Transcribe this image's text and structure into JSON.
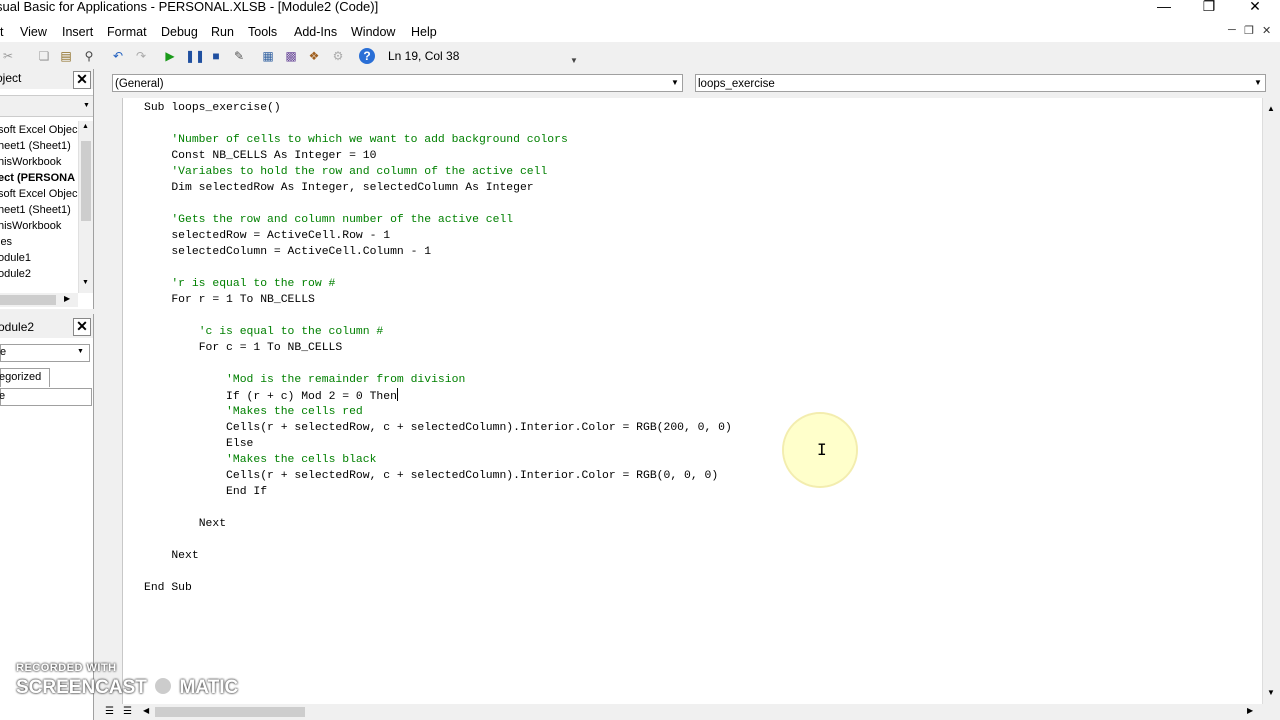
{
  "window": {
    "title": "sual Basic for Applications - PERSONAL.XLSB - [Module2 (Code)]",
    "minimize_icon": "minimize-icon",
    "restore_icon": "restore-icon",
    "close_icon": "close-icon"
  },
  "menu": {
    "items": [
      "t",
      "View",
      "Insert",
      "Format",
      "Debug",
      "Run",
      "Tools",
      "Add-Ins",
      "Window",
      "Help"
    ]
  },
  "toolbar": {
    "position": "Ln 19, Col 38"
  },
  "project_pane": {
    "title": "oject",
    "items": [
      "soft Excel Objec",
      "heet1 (Sheet1)",
      "hisWorkbook",
      "ect (PERSONA",
      "soft Excel Objec",
      "heet1 (Sheet1)",
      "hisWorkbook",
      "les",
      "odule1",
      "odule2"
    ]
  },
  "properties_pane": {
    "title": "odule2",
    "dropdown_value": "e",
    "tab_label": "egorized",
    "selected_row": "e"
  },
  "editor": {
    "object_combo": "(General)",
    "procedure_combo": "loops_exercise",
    "code_lines": [
      {
        "indent": 0,
        "text": "Sub loops_exercise()",
        "comment": false
      },
      {
        "indent": 0,
        "text": "",
        "comment": false
      },
      {
        "indent": 1,
        "text": "'Number of cells to which we want to add background colors",
        "comment": true
      },
      {
        "indent": 1,
        "text": "Const NB_CELLS As Integer = 10",
        "comment": false
      },
      {
        "indent": 1,
        "text": "'Variabes to hold the row and column of the active cell",
        "comment": true
      },
      {
        "indent": 1,
        "text": "Dim selectedRow As Integer, selectedColumn As Integer",
        "comment": false
      },
      {
        "indent": 0,
        "text": "",
        "comment": false
      },
      {
        "indent": 1,
        "text": "'Gets the row and column number of the active cell",
        "comment": true
      },
      {
        "indent": 1,
        "text": "selectedRow = ActiveCell.Row - 1",
        "comment": false
      },
      {
        "indent": 1,
        "text": "selectedColumn = ActiveCell.Column - 1",
        "comment": false
      },
      {
        "indent": 0,
        "text": "",
        "comment": false
      },
      {
        "indent": 1,
        "text": "'r is equal to the row #",
        "comment": true
      },
      {
        "indent": 1,
        "text": "For r = 1 To NB_CELLS",
        "comment": false
      },
      {
        "indent": 0,
        "text": "",
        "comment": false
      },
      {
        "indent": 2,
        "text": "'c is equal to the column #",
        "comment": true
      },
      {
        "indent": 2,
        "text": "For c = 1 To NB_CELLS",
        "comment": false
      },
      {
        "indent": 0,
        "text": "",
        "comment": false
      },
      {
        "indent": 3,
        "text": "'Mod is the remainder from division",
        "comment": true
      },
      {
        "indent": 3,
        "text": "If (r + c) Mod 2 = 0 Then",
        "comment": false,
        "caret": true
      },
      {
        "indent": 3,
        "text": "'Makes the cells red",
        "comment": true
      },
      {
        "indent": 3,
        "text": "Cells(r + selectedRow, c + selectedColumn).Interior.Color = RGB(200, 0, 0)",
        "comment": false
      },
      {
        "indent": 3,
        "text": "Else",
        "comment": false
      },
      {
        "indent": 3,
        "text": "'Makes the cells black",
        "comment": true
      },
      {
        "indent": 3,
        "text": "Cells(r + selectedRow, c + selectedColumn).Interior.Color = RGB(0, 0, 0)",
        "comment": false
      },
      {
        "indent": 3,
        "text": "End If",
        "comment": false
      },
      {
        "indent": 0,
        "text": "",
        "comment": false
      },
      {
        "indent": 2,
        "text": "Next",
        "comment": false
      },
      {
        "indent": 0,
        "text": "",
        "comment": false
      },
      {
        "indent": 1,
        "text": "Next",
        "comment": false
      },
      {
        "indent": 0,
        "text": "",
        "comment": false
      },
      {
        "indent": 0,
        "text": "End Sub",
        "comment": false
      }
    ]
  },
  "watermark": {
    "line1": "RECORDED WITH",
    "line2a": "SCREENCAST",
    "line2b": "MATIC"
  },
  "colors": {
    "comment": "#008000",
    "code": "#000000",
    "cursor_highlight": "#ffffa0"
  }
}
